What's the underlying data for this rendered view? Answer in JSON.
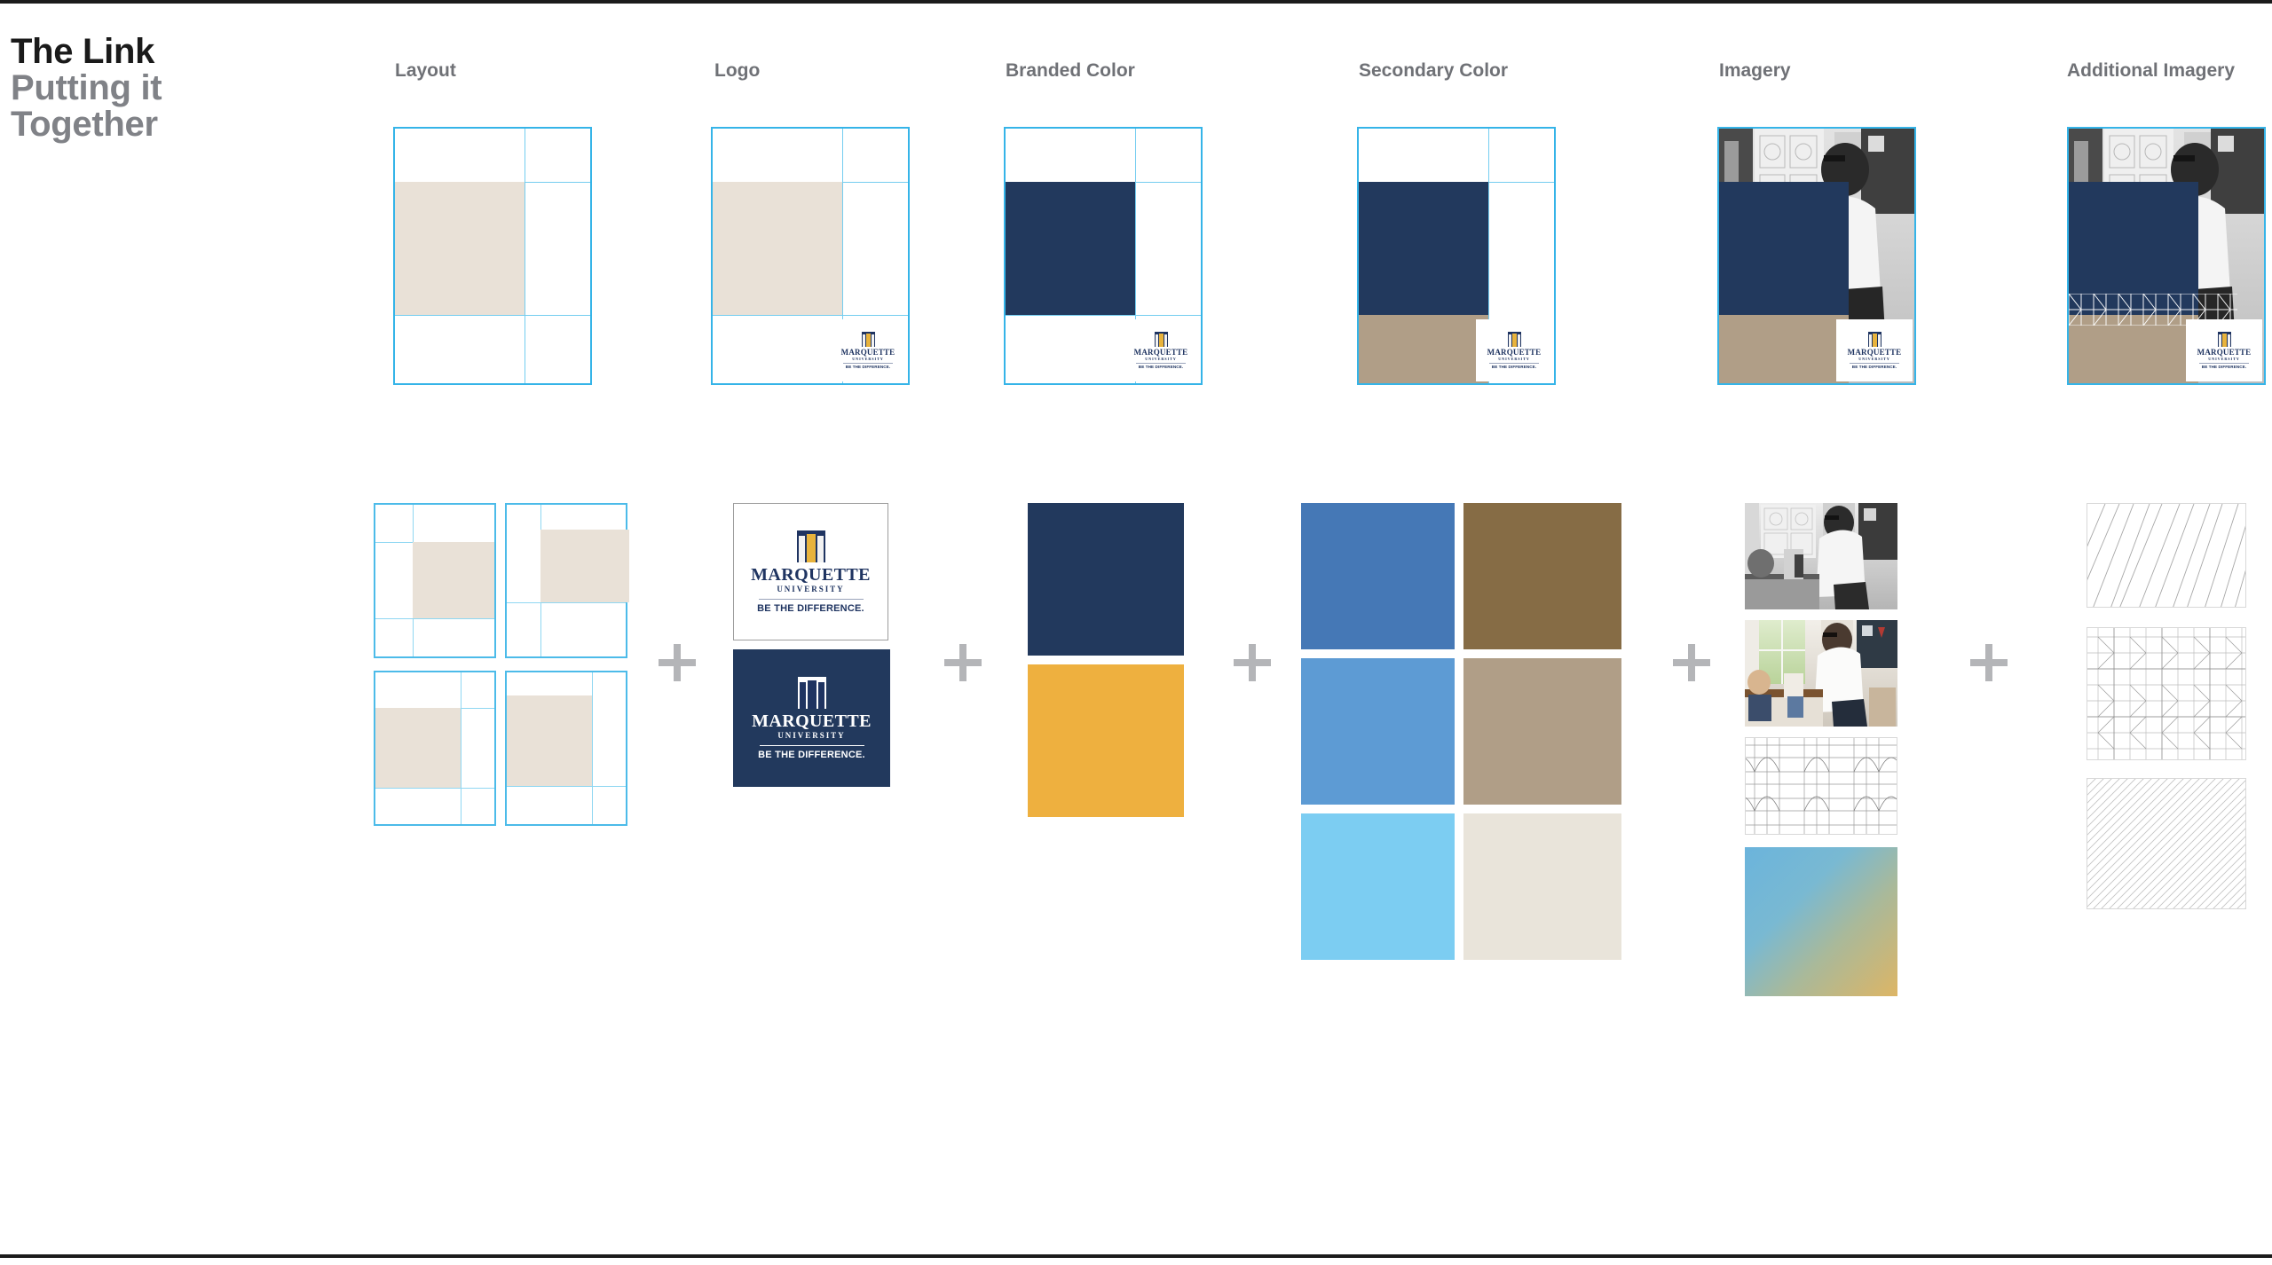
{
  "page": {
    "title_main": "The Link",
    "title_sub_line1": "Putting it",
    "title_sub_line2": "Together",
    "rule_color": "#1b1b1b",
    "background": "#ffffff",
    "plus_separator_glyph": "+",
    "plus_color": "#b4b5b8"
  },
  "columns": [
    {
      "key": "layout",
      "header": "Layout",
      "card": {
        "description": "page layout wireframe with beige content block",
        "outline_color": "#35b4e8",
        "block_color": "#e9e1d7"
      },
      "items": [
        {
          "name": "layout-variant-1",
          "block_position": "center-right"
        },
        {
          "name": "layout-variant-2",
          "block_position": "top-right"
        },
        {
          "name": "layout-variant-3",
          "block_position": "center-left"
        },
        {
          "name": "layout-variant-4",
          "block_position": "top-left"
        }
      ]
    },
    {
      "key": "logo",
      "header": "Logo",
      "card": {
        "description": "layout wireframe with Marquette logo locked bottom right",
        "outline_color": "#35b4e8",
        "block_color": "#e9e1d7"
      },
      "items": [
        {
          "name": "logo-light",
          "background": "#ffffff",
          "foreground": "#1f3461"
        },
        {
          "name": "logo-dark",
          "background": "#22395d",
          "foreground": "#ffffff"
        }
      ]
    },
    {
      "key": "branded_color",
      "header": "Branded Color",
      "card": {
        "description": "layout wireframe with navy branded block and logo",
        "outline_color": "#35b4e8",
        "block_color": "#22395d"
      },
      "items": [
        {
          "name": "swatch-marquette-navy",
          "hex": "#22395d"
        },
        {
          "name": "swatch-marquette-gold",
          "hex": "#eeb03f"
        }
      ]
    },
    {
      "key": "secondary_color",
      "header": "Secondary Color",
      "card": {
        "description": "layout wireframe with navy block plus tan secondary block",
        "outline_color": "#35b4e8",
        "block_color": "#22395d",
        "secondary_block_color": "#b09e87"
      },
      "items": [
        {
          "name": "swatch-medium-blue",
          "hex": "#4578b6"
        },
        {
          "name": "swatch-brown",
          "hex": "#866c45"
        },
        {
          "name": "swatch-light-blue",
          "hex": "#5d9bd4"
        },
        {
          "name": "swatch-taupe",
          "hex": "#b09e87"
        },
        {
          "name": "swatch-sky-blue",
          "hex": "#7ccdf2"
        },
        {
          "name": "swatch-cream",
          "hex": "#e9e4da"
        }
      ]
    },
    {
      "key": "imagery",
      "header": "Imagery",
      "card": {
        "description": "layout with black-and-white photograph behind navy and tan blocks",
        "outline_color": "#35b4e8"
      },
      "items": [
        {
          "name": "photo-bw-classroom",
          "kind": "photo",
          "treatment": "black-and-white"
        },
        {
          "name": "photo-color-classroom",
          "kind": "photo",
          "treatment": "color"
        },
        {
          "name": "pattern-gothic-arches",
          "kind": "pattern"
        },
        {
          "name": "gradient-blue-gold",
          "kind": "gradient",
          "from": "#6bb4dc",
          "to": "#ddb565"
        }
      ]
    },
    {
      "key": "additional_imagery",
      "header": "Additional Imagery",
      "card": {
        "description": "layout with photo, navy block, tan block and triangular line pattern band",
        "outline_color": "#35b4e8"
      },
      "items": [
        {
          "name": "pattern-sparse-diagonal-lines",
          "kind": "pattern"
        },
        {
          "name": "pattern-triangle-grid",
          "kind": "pattern"
        },
        {
          "name": "pattern-dense-diagonal-hatch",
          "kind": "pattern"
        }
      ]
    }
  ],
  "logo": {
    "wordmark": "MARQUETTE",
    "subword": "UNIVERSITY",
    "tagline": "BE THE DIFFERENCE.",
    "crest_name": "marquette-crest-icon"
  }
}
